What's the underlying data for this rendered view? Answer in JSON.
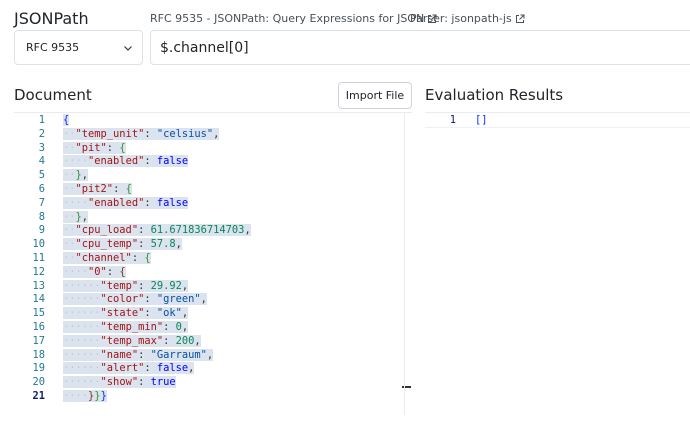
{
  "header": {
    "title": "JSONPath",
    "links": [
      {
        "label": "RFC 9535 - JSONPath: Query Expressions for JSON",
        "icon": "external-link-icon"
      },
      {
        "label": "Parser: jsonpath-js",
        "icon": "external-link-icon"
      }
    ]
  },
  "controls": {
    "spec_select": {
      "value": "RFC 9535",
      "icon": "chevron-down-icon"
    },
    "query": {
      "value": "$.channel[0]"
    }
  },
  "document": {
    "title": "Document",
    "import_label": "Import File",
    "lines": [
      "1",
      "2",
      "3",
      "4",
      "5",
      "6",
      "7",
      "8",
      "9",
      "10",
      "11",
      "12",
      "13",
      "14",
      "15",
      "16",
      "17",
      "18",
      "19",
      "20",
      "21"
    ],
    "active_line": "21",
    "values": {
      "temp_unit": "\"celsius\"",
      "pit_enabled": "false",
      "pit2_enabled": "false",
      "cpu_load": "61.671836714703",
      "cpu_temp": "57.8",
      "temp": "29.92",
      "color": "\"green\"",
      "state": "\"ok\"",
      "temp_min": "0",
      "temp_max": "200",
      "name": "\"Garraum\"",
      "alert": "false",
      "show": "true"
    }
  },
  "results": {
    "title": "Evaluation Results",
    "lines": [
      {
        "number": "1",
        "text": "[]"
      }
    ]
  },
  "colors": {
    "key": "#a31515",
    "string": "#0451a5",
    "number": "#098658",
    "line_number": "#237893"
  }
}
